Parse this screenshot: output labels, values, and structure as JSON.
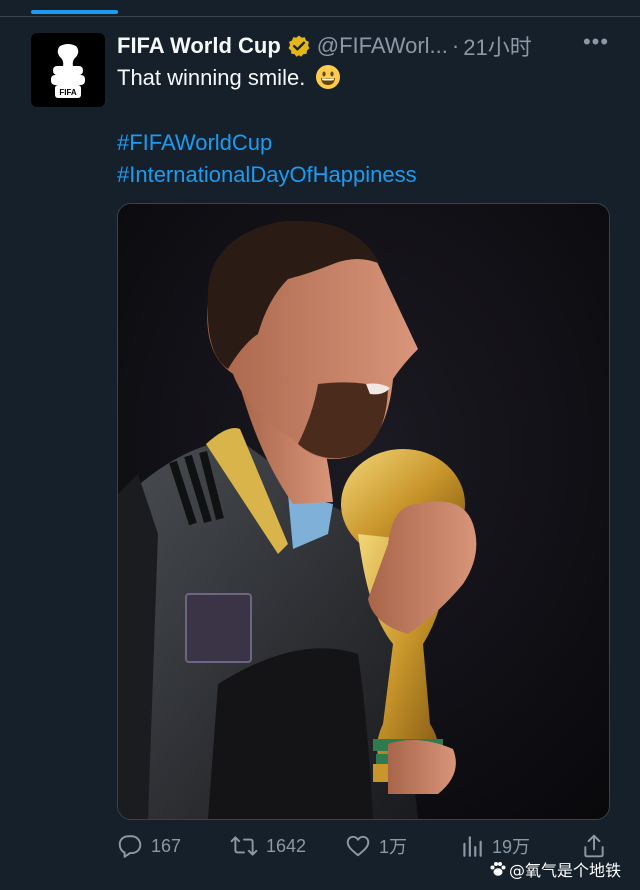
{
  "tweet": {
    "display_name": "FIFA World Cup",
    "handle": "@FIFAWorl...",
    "separator": "·",
    "time": "21小时",
    "text": "That winning smile.",
    "emoji": "grinning-face",
    "hashtags": [
      "#FIFAWorldCup",
      "#InternationalDayOfHappiness"
    ],
    "more_label": "•••",
    "avatar_logo_text": "FIFA"
  },
  "actions": {
    "replies": "167",
    "retweets": "1642",
    "likes": "1万",
    "views": "19万"
  },
  "watermark": {
    "text": "@氧气是个地铁",
    "icon": "paw-icon"
  },
  "colors": {
    "background": "#15202b",
    "accent": "#1d9bf0",
    "secondary_text": "#8b98a5",
    "primary_text": "#f7f9f9",
    "border": "#38444d",
    "verified_badge": "#e2b719"
  }
}
